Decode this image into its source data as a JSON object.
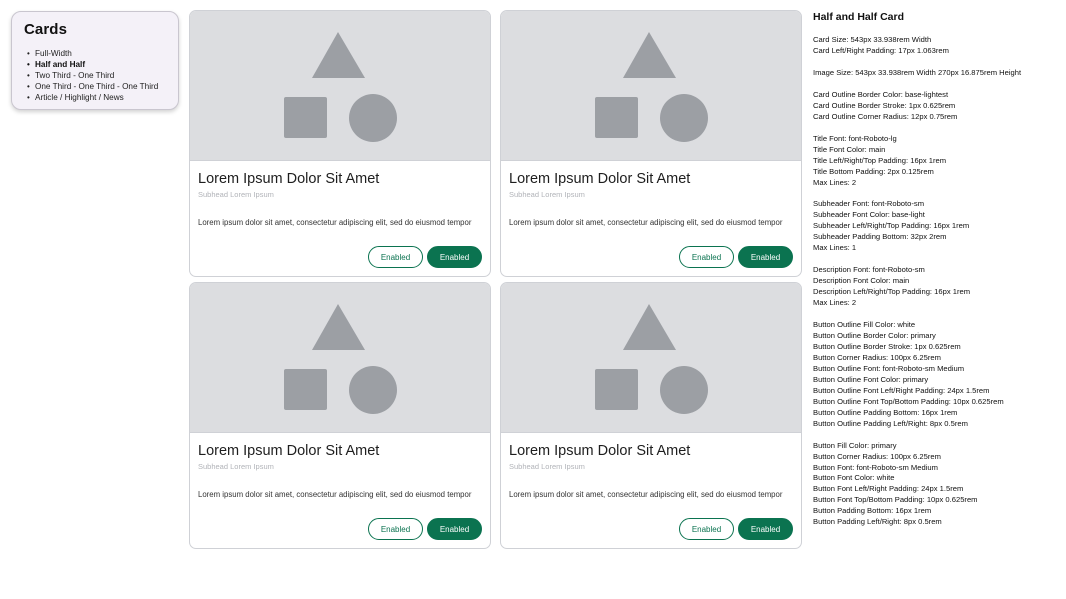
{
  "nav": {
    "title": "Cards",
    "items": [
      {
        "label": "Full-Width",
        "active": false
      },
      {
        "label": "Half and Half",
        "active": true
      },
      {
        "label": "Two Third - One Third",
        "active": false
      },
      {
        "label": "One Third - One Third - One Third",
        "active": false
      },
      {
        "label": "Article / Highlight / News",
        "active": false
      }
    ]
  },
  "cards": [
    {
      "title": "Lorem Ipsum Dolor Sit Amet",
      "subhead": "Subhead Lorem Ipsum",
      "description": "Lorem ipsum dolor sit amet, consectetur adipiscing elit, sed do eiusmod tempor",
      "outline_button": "Enabled",
      "fill_button": "Enabled"
    },
    {
      "title": "Lorem Ipsum Dolor Sit Amet",
      "subhead": "Subhead Lorem Ipsum",
      "description": "Lorem ipsum dolor sit amet, consectetur adipiscing elit, sed do eiusmod tempor",
      "outline_button": "Enabled",
      "fill_button": "Enabled"
    },
    {
      "title": "Lorem Ipsum Dolor Sit Amet",
      "subhead": "Subhead Lorem Ipsum",
      "description": "Lorem ipsum dolor sit amet, consectetur adipiscing elit, sed do eiusmod tempor",
      "outline_button": "Enabled",
      "fill_button": "Enabled"
    },
    {
      "title": "Lorem Ipsum Dolor Sit Amet",
      "subhead": "Subhead Lorem Ipsum",
      "description": "Lorem ipsum dolor sit amet, consectetur adipiscing elit, sed do eiusmod tempor",
      "outline_button": "Enabled",
      "fill_button": "Enabled"
    }
  ],
  "placeholder_icon": "shapes-placeholder-icon",
  "colors": {
    "primary": "#0b7350",
    "media_background": "#dcdde0",
    "placeholder_shape": "#9c9fa4",
    "nav_background": "#f4f1f8"
  },
  "spec": {
    "heading": "Half and Half Card",
    "groups": [
      [
        "Card Size: 543px 33.938rem Width",
        "Card Left/Right Padding: 17px 1.063rem"
      ],
      [
        "Image Size: 543px 33.938rem Width 270px 16.875rem Height"
      ],
      [
        "Card Outline Border Color: base-lightest",
        "Card Outline Border Stroke: 1px 0.625rem",
        "Card Outline Corner Radius: 12px 0.75rem"
      ],
      [
        "Title Font: font-Roboto-lg",
        "Title Font Color: main",
        "Title Left/Right/Top Padding: 16px 1rem",
        "Title Bottom Padding: 2px 0.125rem",
        "Max Lines: 2"
      ],
      [
        "Subheader Font: font-Roboto-sm",
        "Subheader Font Color: base-light",
        "Subheader Left/Right/Top Padding: 16px 1rem",
        "Subheader Padding Bottom: 32px 2rem",
        "Max Lines: 1"
      ],
      [
        "Description Font: font-Roboto-sm",
        "Description Font Color: main",
        "Description Left/Right/Top Padding: 16px 1rem",
        "Max Lines: 2"
      ],
      [
        "Button Outline Fill Color: white",
        "Button Outline Border Color: primary",
        "Button Outline Border Stroke: 1px 0.625rem",
        "Button Corner Radius: 100px 6.25rem",
        "Button Outline Font: font-Roboto-sm Medium",
        "Button Outline Font Color: primary",
        "Button Outline Font Left/Right Padding: 24px 1.5rem",
        "Button Outline Font Top/Bottom Padding: 10px 0.625rem",
        "Button Outline Padding Bottom: 16px 1rem",
        "Button Outline Padding Left/Right: 8px 0.5rem"
      ],
      [
        "Button Fill Color: primary",
        "Button Corner Radius: 100px 6.25rem",
        "Button Font: font-Roboto-sm Medium",
        "Button Font Color: white",
        "Button Font Left/Right Padding: 24px 1.5rem",
        "Button Font Top/Bottom Padding: 10px 0.625rem",
        "Button Padding Bottom: 16px 1rem",
        "Button Padding Left/Right: 8px 0.5rem"
      ]
    ]
  }
}
